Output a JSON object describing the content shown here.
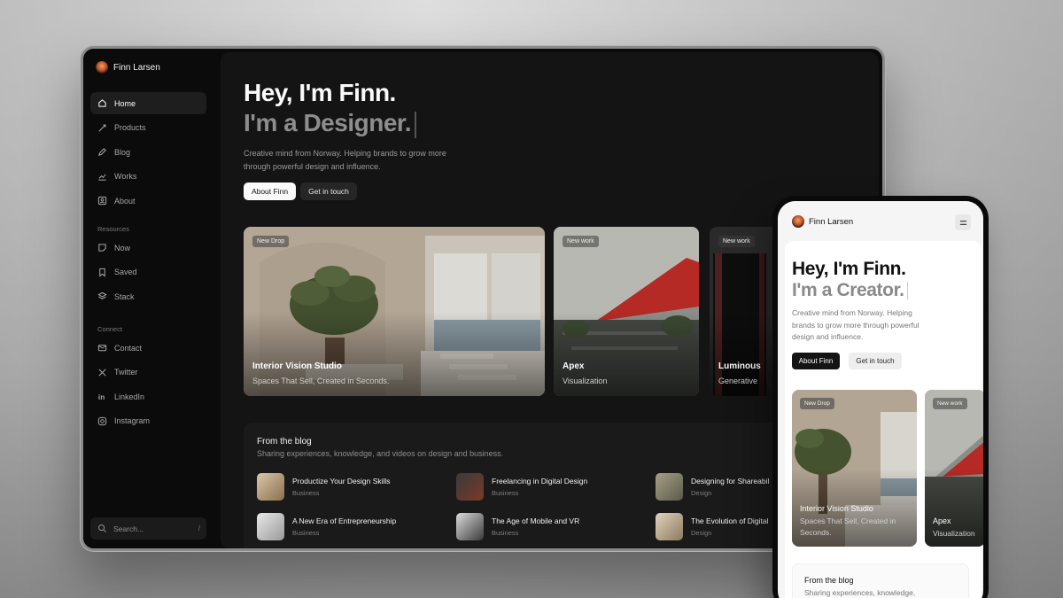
{
  "desktop": {
    "brand": {
      "name": "Finn Larsen"
    },
    "sidebar": {
      "main_items": [
        {
          "label": "Home",
          "icon": "home-icon"
        },
        {
          "label": "Products",
          "icon": "rocket-icon"
        },
        {
          "label": "Blog",
          "icon": "pen-icon"
        },
        {
          "label": "Works",
          "icon": "chart-icon"
        },
        {
          "label": "About",
          "icon": "user-icon"
        }
      ],
      "resources_label": "Resources",
      "resources_items": [
        {
          "label": "Now",
          "icon": "note-icon"
        },
        {
          "label": "Saved",
          "icon": "bookmark-icon"
        },
        {
          "label": "Stack",
          "icon": "layers-icon"
        }
      ],
      "connect_label": "Connect",
      "connect_items": [
        {
          "label": "Contact",
          "icon": "mail-icon"
        },
        {
          "label": "Twitter",
          "icon": "x-icon"
        },
        {
          "label": "LinkedIn",
          "icon": "linkedin-icon"
        },
        {
          "label": "Instagram",
          "icon": "instagram-icon"
        }
      ],
      "search_placeholder": "Search...",
      "search_shortcut": "/"
    },
    "hero": {
      "line1": "Hey, I'm Finn.",
      "line2": "I'm a Designer.",
      "subtitle": "Creative mind from Norway. Helping brands to grow more through powerful design and influence.",
      "primary_button": "About Finn",
      "secondary_button": "Get in touch"
    },
    "cards": [
      {
        "tag": "New Drop",
        "title": "Interior Vision Studio",
        "subtitle": "Spaces That Sell, Created in Seconds."
      },
      {
        "tag": "New work",
        "title": "Apex",
        "subtitle": "Visualization"
      },
      {
        "tag": "New work",
        "title": "Luminous",
        "subtitle": "Generative"
      }
    ],
    "blog": {
      "title": "From the blog",
      "subtitle": "Sharing experiences, knowledge, and videos on design and business.",
      "posts": [
        {
          "title": "Productize Your Design Skills",
          "category": "Business"
        },
        {
          "title": "Freelancing in Digital Design",
          "category": "Business"
        },
        {
          "title": "Designing for Shareabil",
          "category": "Design"
        },
        {
          "title": "A New Era of Entrepreneurship",
          "category": "Business"
        },
        {
          "title": "The Age of Mobile and VR",
          "category": "Business"
        },
        {
          "title": "The Evolution of Digital",
          "category": "Design"
        }
      ]
    }
  },
  "mobile": {
    "brand": {
      "name": "Finn Larsen"
    },
    "menu_icon": "menu-icon",
    "hero": {
      "line1": "Hey, I'm Finn.",
      "line2": "I'm a Creator.",
      "subtitle": "Creative mind from Norway. Helping brands to grow more through powerful design and influence.",
      "primary_button": "About Finn",
      "secondary_button": "Get in touch"
    },
    "cards": [
      {
        "tag": "New Drop",
        "title": "Interior Vision Studio",
        "subtitle": "Spaces That Sell, Created in Seconds."
      },
      {
        "tag": "New work",
        "title": "Apex",
        "subtitle": "Visualization"
      }
    ],
    "blog": {
      "title": "From the blog",
      "subtitle": "Sharing experiences, knowledge,"
    }
  }
}
